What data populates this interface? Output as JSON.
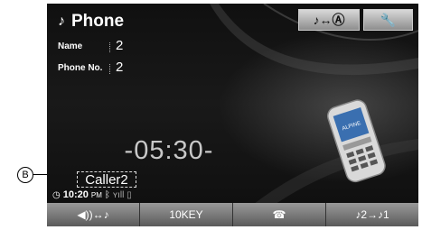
{
  "header": {
    "title": "Phone",
    "title_icon": "music-note-icon",
    "source_switch_label": "♪↔Ⓐ",
    "settings_icon": "wrench-icon"
  },
  "info": {
    "name_label": "Name",
    "name_value": "2",
    "phone_label": "Phone No.",
    "phone_value": "2"
  },
  "clock": "-05:30-",
  "caller": "Caller2",
  "status": {
    "time": "10:20",
    "ampm": "PM"
  },
  "bottom_bar": [
    {
      "label": "◀))↔♪"
    },
    {
      "label": "10KEY"
    },
    {
      "label": "☎"
    },
    {
      "label": "♪2→♪1"
    }
  ],
  "phone_brand": "ALPINE",
  "callout": "B"
}
